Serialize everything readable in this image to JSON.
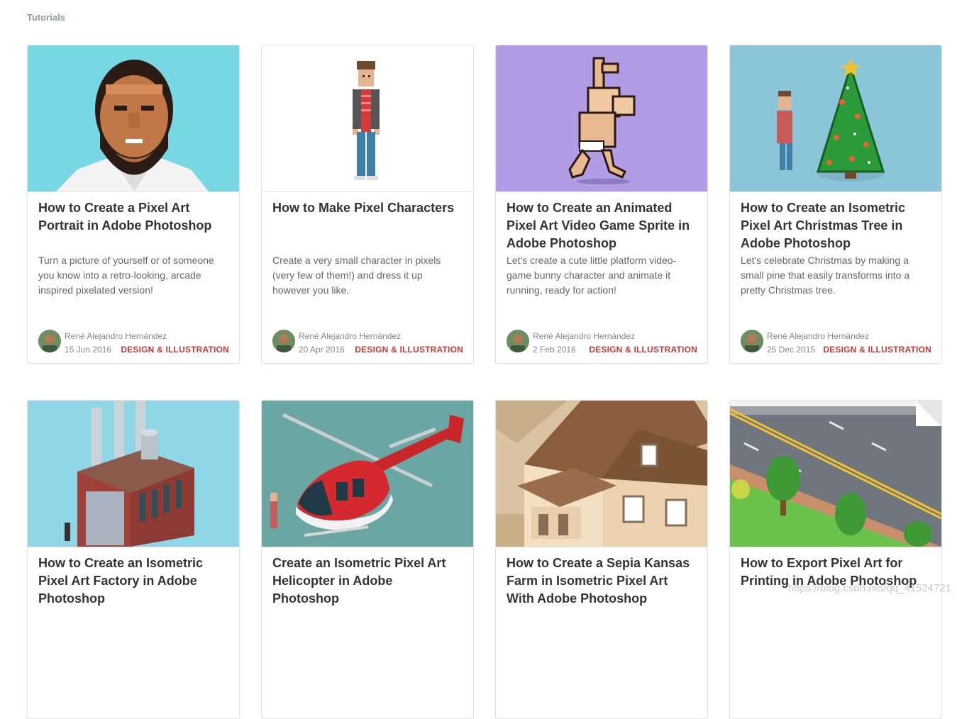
{
  "section_label": "Tutorials",
  "colors": {
    "accent": "#c33b36"
  },
  "cards": [
    {
      "title": "How to Create a Pixel Art Portrait in Adobe Photoshop",
      "description": "Turn a picture of yourself or of someone you know into a retro-looking, arcade inspired pixelated version!",
      "author": "René Alejandro Hernández",
      "date": "15 Jun 2016",
      "category": "DESIGN & ILLUSTRATION",
      "thumb_bg": "#77d8e4"
    },
    {
      "title": "How to Make Pixel Characters",
      "description": "Create a very small character in pixels (very few of them!) and dress it up however you like.",
      "author": "René Alejandro Hernández",
      "date": "20 Apr 2016",
      "category": "DESIGN & ILLUSTRATION",
      "thumb_bg": "#ffffff"
    },
    {
      "title": "How to Create an Animated Pixel Art Video Game Sprite in Adobe Photoshop",
      "description": "Let's create a cute little platform video-game bunny character and animate it running, ready for action!",
      "author": "René Alejandro Hernández",
      "date": "2 Feb 2016",
      "category": "DESIGN & ILLUSTRATION",
      "thumb_bg": "#b39ce6"
    },
    {
      "title": "How to Create an Isometric Pixel Art Christmas Tree in Adobe Photoshop",
      "description": "Let's celebrate Christmas by making a small pine that easily transforms into a pretty Christmas tree.",
      "author": "René Alejandro Hernández",
      "date": "25 Dec 2015",
      "category": "DESIGN & ILLUSTRATION",
      "thumb_bg": "#8bc5d8"
    },
    {
      "title": "How to Create an Isometric Pixel Art Factory in Adobe Photoshop",
      "thumb_bg": "#8fd6e6"
    },
    {
      "title": "Create an Isometric Pixel Art Helicopter in Adobe Photoshop",
      "thumb_bg": "#6aa6a3"
    },
    {
      "title": "How to Create a Sepia Kansas Farm in Isometric Pixel Art With Adobe Photoshop",
      "thumb_bg": "#d9c3a3"
    },
    {
      "title": "How to Export Pixel Art for Printing in Adobe Photoshop",
      "thumb_bg": "#7a7f86"
    }
  ],
  "watermark": "https://blog.csdn.net/qq_41524721"
}
